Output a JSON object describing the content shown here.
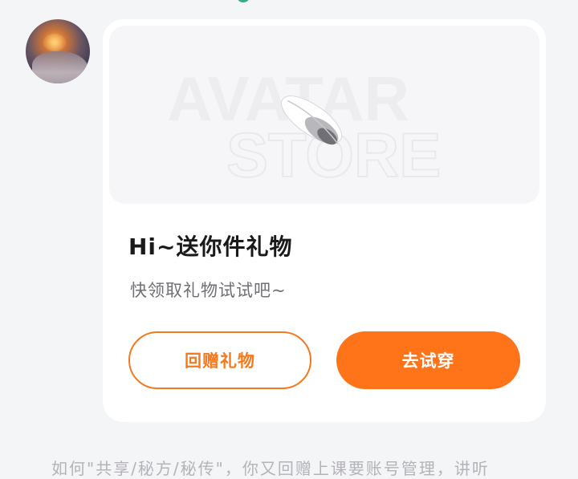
{
  "avatar": {
    "alt": "user avatar"
  },
  "gift_card": {
    "banner": {
      "line1": "AVATAR",
      "line2": "STORE",
      "icon": "feather-icon"
    },
    "title": "Hi~送你件礼物",
    "subtitle": "快领取礼物试试吧~",
    "buttons": {
      "regift": "回赠礼物",
      "try": "去试穿"
    }
  },
  "bottom_text": "如何\"共享/秘方/秘传\"，你又回赠上课要账号管理，讲听",
  "colors": {
    "accent": "#ff7418",
    "card_bg": "#ffffff",
    "page_bg": "#f4f5f7"
  }
}
